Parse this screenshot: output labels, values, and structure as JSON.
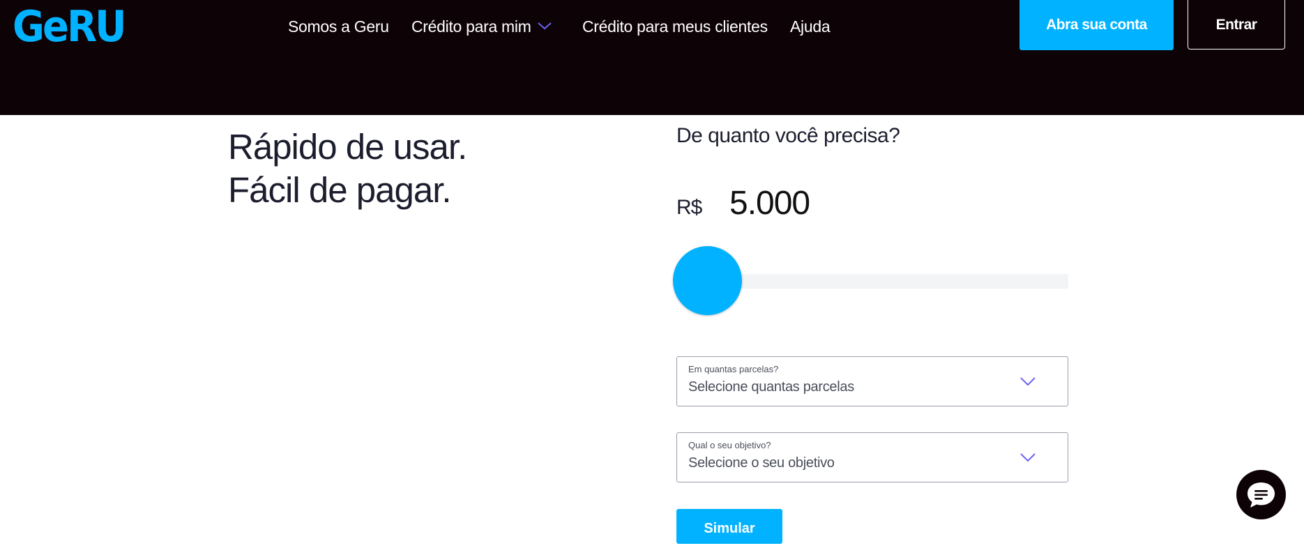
{
  "colors": {
    "brand": "#00b2ff",
    "header_bg": "#0d0206",
    "nav_accent": "#6a62f2"
  },
  "header": {
    "logo": "GeRU",
    "nav": [
      {
        "label": "Somos a Geru"
      },
      {
        "label": "Crédito para mim",
        "icon": "chevron-down-icon"
      },
      {
        "label": "Crédito para meus clientes"
      },
      {
        "label": "Ajuda"
      }
    ],
    "open_account_label": "Abra sua conta",
    "login_label": "Entrar"
  },
  "hero": {
    "line1": "Rápido de usar.",
    "line2": "Fácil de pagar."
  },
  "simulator": {
    "question": "De quanto você precisa?",
    "currency": "R$",
    "amount": "5.000",
    "slider_fraction": 0.0,
    "installments": {
      "label": "Em quantas parcelas?",
      "value": "Selecione quantas parcelas"
    },
    "objective": {
      "label": "Qual o seu objetivo?",
      "value": "Selecione o seu objetivo"
    },
    "submit_label": "Simular"
  },
  "chat": {
    "icon": "chat-bubble-icon"
  }
}
